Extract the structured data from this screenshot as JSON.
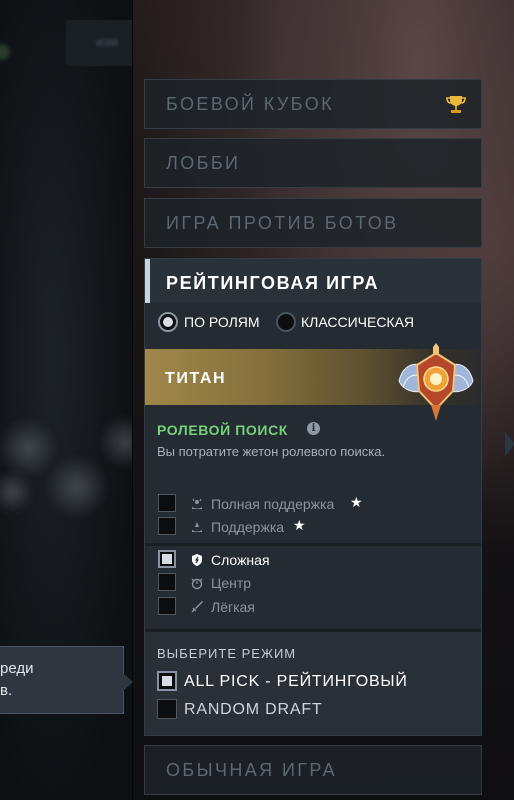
{
  "menu": {
    "battle_cup": "БОЕВОЙ КУБОК",
    "lobby": "ЛОББИ",
    "bots": "ИГРА ПРОТИВ БОТОВ",
    "normal": "ОБЫЧНАЯ ИГРА"
  },
  "ranked": {
    "title": "РЕЙТИНГОВАЯ ИГРА",
    "radio_roles": "ПО РОЛЯМ",
    "radio_classic": "КЛАССИЧЕСКАЯ",
    "selected_radio": "ПО РОЛЯМ",
    "rank_name": "ТИТАН",
    "role_search_title": "РОЛЕВОЙ ПОИСК",
    "role_search_sub": "Вы потратите жетон ролевого поиска.",
    "roles": [
      {
        "label": "Полная поддержка",
        "checked": false,
        "star": true,
        "icon": "hard-support-icon"
      },
      {
        "label": "Поддержка",
        "checked": false,
        "star": true,
        "icon": "soft-support-icon"
      },
      {
        "label": "Сложная",
        "checked": true,
        "star": false,
        "icon": "offlane-shield-icon"
      },
      {
        "label": "Центр",
        "checked": false,
        "star": false,
        "icon": "mid-icon"
      },
      {
        "label": "Лёгкая",
        "checked": false,
        "star": false,
        "icon": "carry-sword-icon"
      }
    ],
    "star_glyph": "★",
    "mode_title": "ВЫБЕРИТЕ РЕЖИМ",
    "modes": [
      {
        "label": "ALL PICK - РЕЙТИНГОВЫЙ",
        "checked": true
      },
      {
        "label": "RANDOM DRAFT",
        "checked": false
      }
    ]
  },
  "tooltip": {
    "line1": "реди",
    "line2": "в."
  },
  "info_glyph": "i",
  "colors": {
    "role_title": "#75d27a",
    "rank_band": "#a0884b",
    "accent": "#c9d4dc"
  }
}
